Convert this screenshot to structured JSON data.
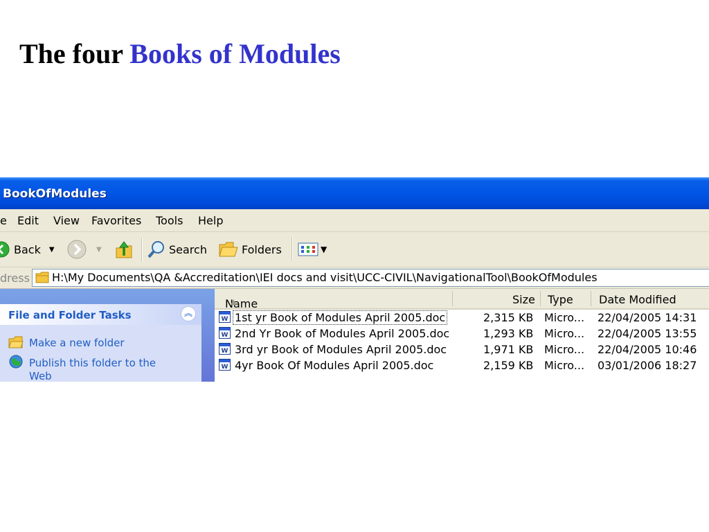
{
  "slide": {
    "title_plain": "The four",
    "title_highlight": "Books of Modules"
  },
  "window": {
    "title": "BookOfModules",
    "menu": [
      "e",
      "Edit",
      "View",
      "Favorites",
      "Tools",
      "Help"
    ],
    "toolbar": {
      "back": "Back",
      "search": "Search",
      "folders": "Folders"
    },
    "address": {
      "label": "dress",
      "path": "H:\\My Documents\\QA &Accreditation\\IEI docs and visit\\UCC-CIVIL\\NavigationalTool\\BookOfModules"
    },
    "task_pane": {
      "title": "File and Folder Tasks",
      "items": [
        "Make a new folder",
        "Publish this folder to the",
        "Web"
      ]
    },
    "columns": [
      "Name",
      "Size",
      "Type",
      "Date Modified"
    ],
    "files": [
      {
        "name": "1st yr Book of Modules April 2005.doc",
        "size": "2,315 KB",
        "type": "Micro...",
        "modified": "22/04/2005 14:31"
      },
      {
        "name": "2nd Yr Book of Modules April 2005.doc",
        "size": "1,293 KB",
        "type": "Micro...",
        "modified": "22/04/2005 13:55"
      },
      {
        "name": "3rd yr Book of Modules April 2005.doc",
        "size": "1,971 KB",
        "type": "Micro...",
        "modified": "22/04/2005 10:46"
      },
      {
        "name": "4yr Book Of Modules April 2005.doc",
        "size": "2,159 KB",
        "type": "Micro...",
        "modified": "03/01/2006 18:27"
      }
    ]
  }
}
